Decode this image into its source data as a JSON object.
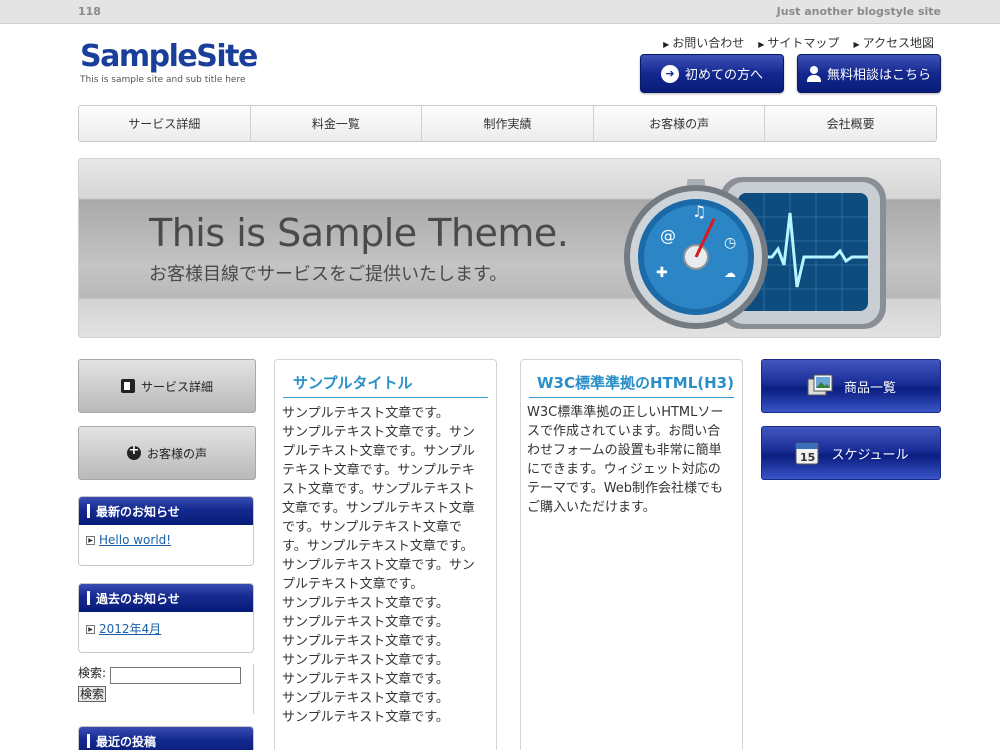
{
  "topbar": {
    "left": "118",
    "right": "Just another blogstyle site"
  },
  "logo": {
    "name": "SampleSite",
    "sub": "This is sample site and sub title here"
  },
  "toplinks": [
    "お問い合わせ",
    "サイトマップ",
    "アクセス地図"
  ],
  "header_buttons": {
    "first": "初めての方へ",
    "consult": "無料相談はこちら"
  },
  "gnav": [
    "サービス詳細",
    "料金一覧",
    "制作実績",
    "お客様の声",
    "会社概要"
  ],
  "hero": {
    "title": "This is Sample Theme.",
    "subtitle": "お客様目線でサービスをご提供いたします。"
  },
  "left_buttons": {
    "service": "サービス詳細",
    "voice": "お客様の声"
  },
  "widgets": {
    "news": {
      "title": "最新のお知らせ",
      "link": "Hello world!"
    },
    "archive": {
      "title": "過去のお知らせ",
      "link": "2012年4月"
    },
    "recent": {
      "title": "最近の投稿"
    }
  },
  "search": {
    "label": "検索:",
    "button": "検索"
  },
  "center": {
    "title": "サンプルタイトル",
    "lines": [
      "サンプルテキスト文章です。",
      "サンプルテキスト文章です。サン",
      "プルテキスト文章です。サンプル",
      "テキスト文章です。サンプルテキ",
      "スト文章です。サンプルテキスト",
      "文章です。サンプルテキスト文章",
      "です。サンプルテキスト文章で",
      "す。サンプルテキスト文章です。",
      "サンプルテキスト文章です。サン",
      "プルテキスト文章です。",
      "サンプルテキスト文章です。",
      "サンプルテキスト文章です。",
      "サンプルテキスト文章です。",
      "サンプルテキスト文章です。",
      "サンプルテキスト文章です。",
      "サンプルテキスト文章です。",
      "サンプルテキスト文章です。"
    ]
  },
  "w3c": {
    "title": "W3C標準準拠のHTML(H3)",
    "lines": [
      "W3C標準準拠の正しいHTMLソー",
      "スで作成されています。お問い合",
      "わせフォームの設置も非常に簡単",
      "にできます。ウィジェット対応の",
      "テーマです。Web制作会社様でも",
      "ご購入いただけます。"
    ]
  },
  "right_buttons": {
    "products": "商品一覧",
    "schedule": "スケジュール",
    "calendar_num": "15"
  }
}
